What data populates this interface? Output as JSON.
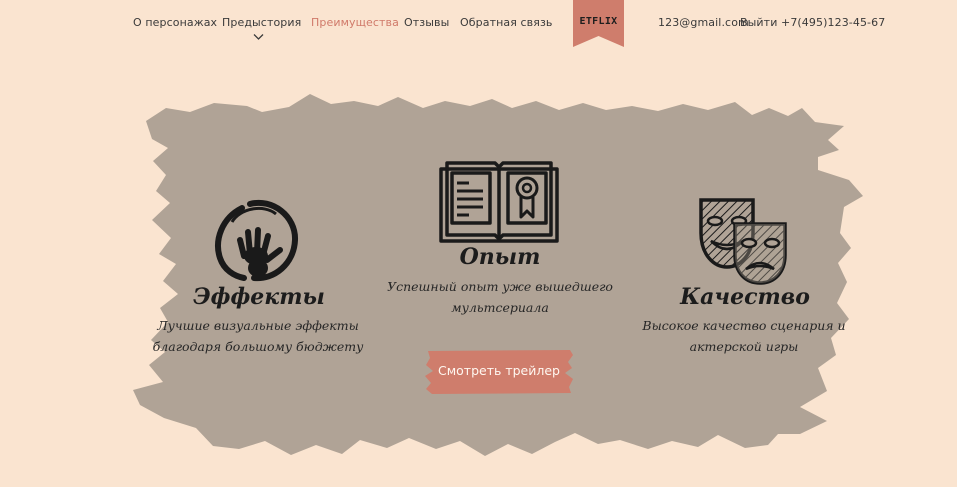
{
  "nav": {
    "items": [
      {
        "label": "О персонажах"
      },
      {
        "label": "Предыстория"
      },
      {
        "label": "Преимущества"
      },
      {
        "label": "Отзывы"
      },
      {
        "label": "Обратная связь"
      }
    ],
    "active_color": "#d07a6a",
    "logo": "ETFLIX",
    "logo_color": "#cf7d6c",
    "email": "123@gmail.com",
    "logout": "Выйти",
    "phone": "+7(495)123-45-67"
  },
  "colors": {
    "background": "#fae4d0",
    "blob": "#b0a396",
    "button": "#cf7d6c"
  },
  "features": [
    {
      "icon": "hand-circle-icon",
      "title": "Эффекты",
      "desc_line1": "Лучшие визуальные эффекты",
      "desc_line2": "благодаря большому бюджету"
    },
    {
      "icon": "book-icon",
      "title": "Опыт",
      "desc_line1": "Успешный опыт уже вышедшего",
      "desc_line2": "мультсериала"
    },
    {
      "icon": "theater-masks-icon",
      "title": "Качество",
      "desc_line1": "Высокое качество сценария и",
      "desc_line2": "актерской игры"
    }
  ],
  "cta": {
    "label": "Смотреть трейлер"
  }
}
